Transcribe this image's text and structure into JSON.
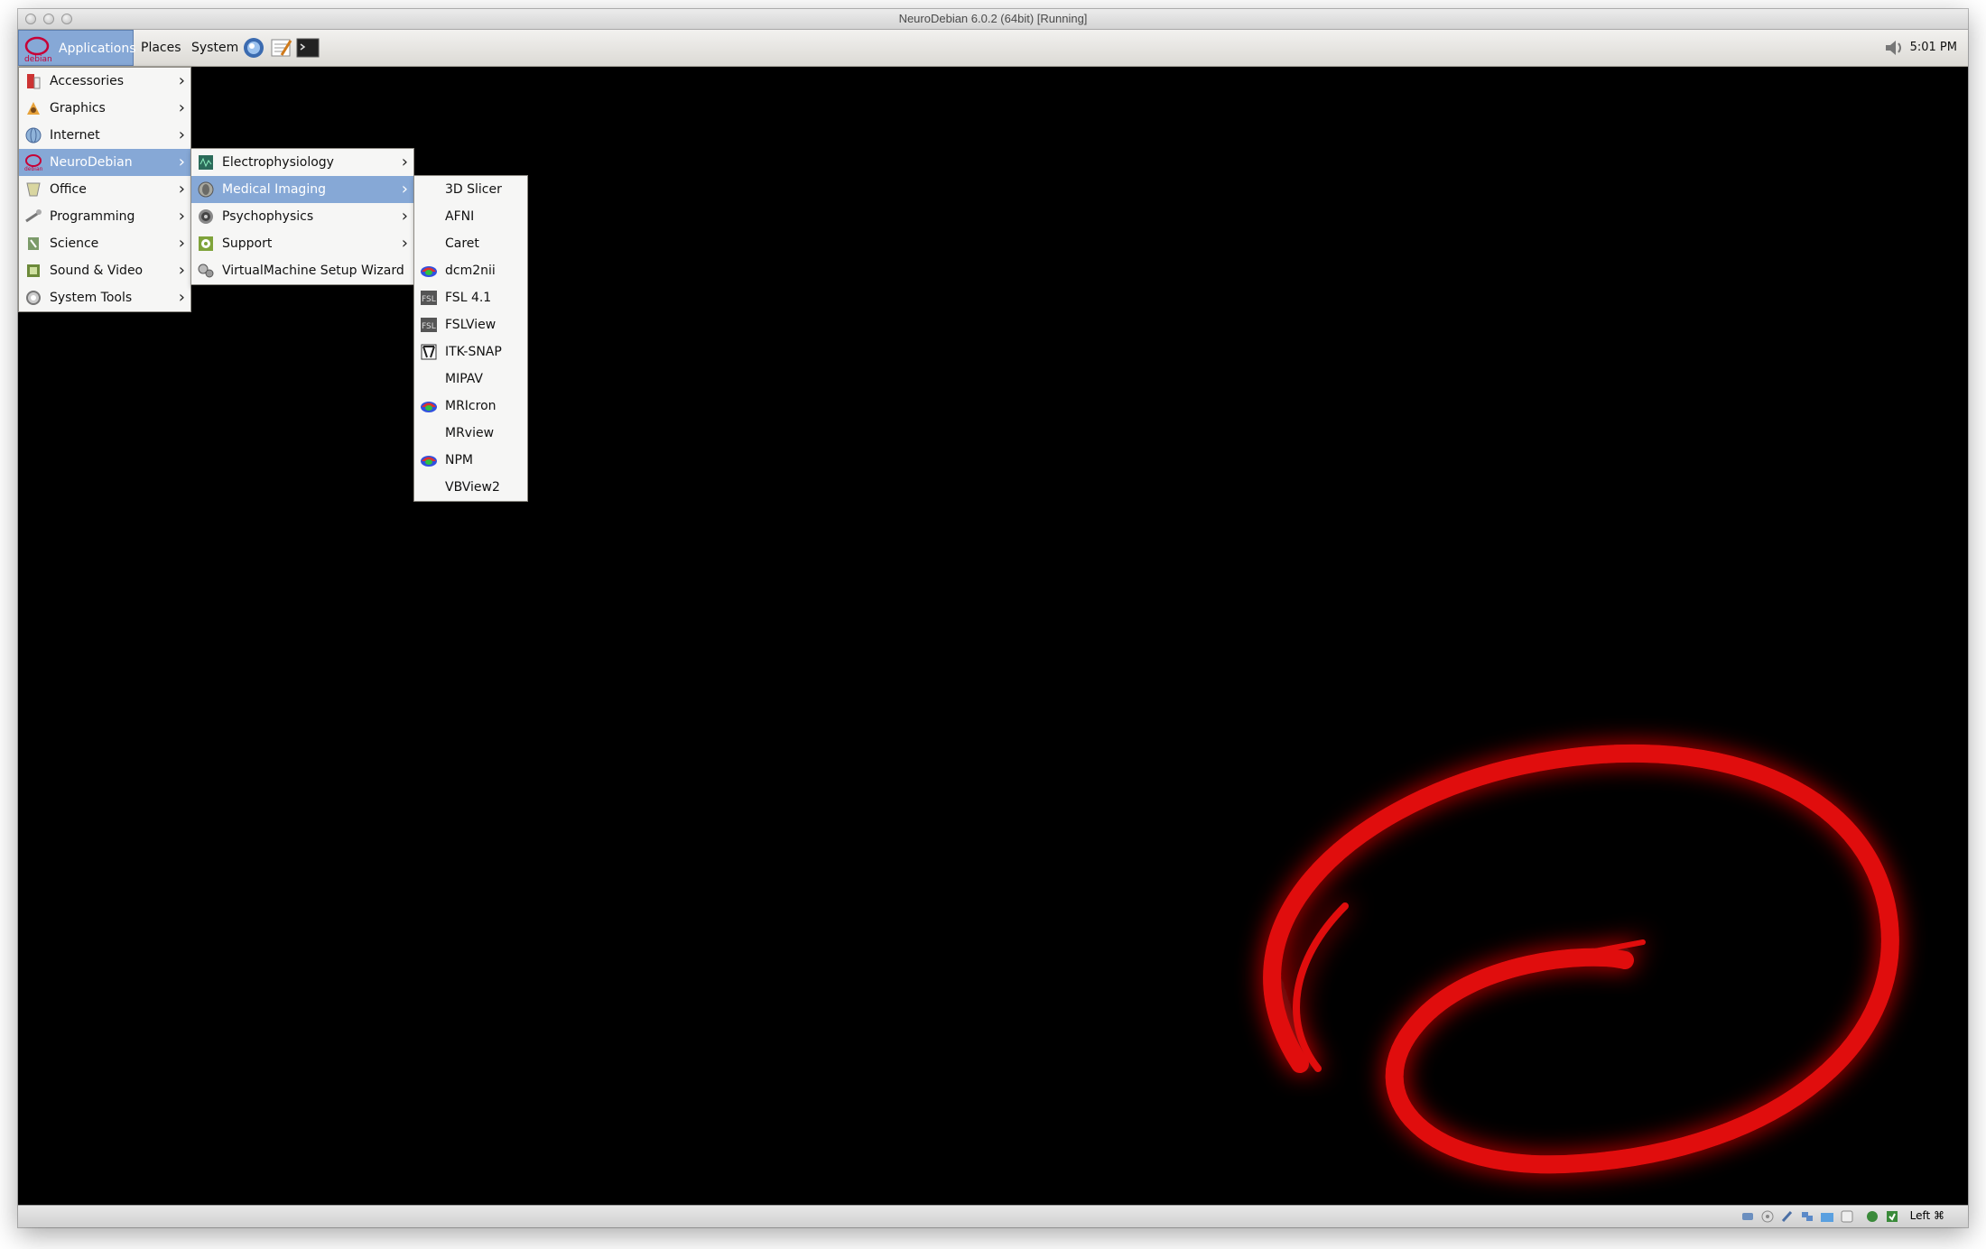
{
  "window": {
    "title": "NeuroDebian 6.0.2  (64bit) [Running]"
  },
  "panel": {
    "applications": "Applications",
    "places": "Places",
    "system": "System",
    "clock": "5:01 PM",
    "launchers": [
      "web-browser-icon",
      "text-editor-icon",
      "terminal-icon"
    ]
  },
  "menu_main": [
    {
      "label": "Accessories",
      "icon": "accessories-icon"
    },
    {
      "label": "Graphics",
      "icon": "graphics-icon"
    },
    {
      "label": "Internet",
      "icon": "internet-icon"
    },
    {
      "label": "NeuroDebian",
      "icon": "neurodebian-icon"
    },
    {
      "label": "Office",
      "icon": "office-icon"
    },
    {
      "label": "Programming",
      "icon": "programming-icon"
    },
    {
      "label": "Science",
      "icon": "science-icon"
    },
    {
      "label": "Sound & Video",
      "icon": "sound-video-icon"
    },
    {
      "label": "System Tools",
      "icon": "system-tools-icon"
    }
  ],
  "menu_neurodebian": [
    {
      "label": "Electrophysiology",
      "icon": "electrophysiology-icon"
    },
    {
      "label": "Medical Imaging",
      "icon": "medical-imaging-icon"
    },
    {
      "label": "Psychophysics",
      "icon": "psychophysics-icon"
    },
    {
      "label": "Support",
      "icon": "support-icon"
    },
    {
      "label": "VirtualMachine Setup Wizard",
      "icon": "vm-wizard-icon"
    }
  ],
  "menu_medical": [
    {
      "label": "3D Slicer",
      "icon": ""
    },
    {
      "label": "AFNI",
      "icon": ""
    },
    {
      "label": "Caret",
      "icon": ""
    },
    {
      "label": "dcm2nii",
      "icon": "brain-color-icon"
    },
    {
      "label": "FSL 4.1",
      "icon": "fsl-icon"
    },
    {
      "label": "FSLView",
      "icon": "fsl-icon"
    },
    {
      "label": "ITK-SNAP",
      "icon": "itksnap-icon"
    },
    {
      "label": "MIPAV",
      "icon": ""
    },
    {
      "label": "MRIcron",
      "icon": "brain-color-icon"
    },
    {
      "label": "MRview",
      "icon": ""
    },
    {
      "label": "NPM",
      "icon": "brain-color-icon"
    },
    {
      "label": "VBView2",
      "icon": ""
    }
  ],
  "statusbar": {
    "host_key": "Left ⌘"
  },
  "colors": {
    "menu_highlight": "#86a8d6",
    "swirl": "#e01010"
  }
}
